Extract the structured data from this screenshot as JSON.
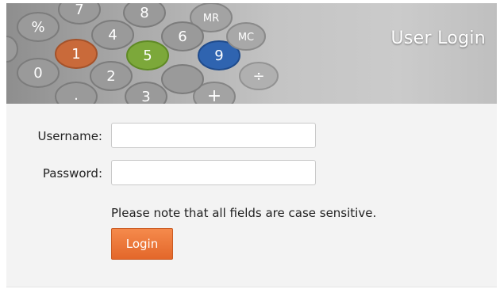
{
  "banner": {
    "title": "User Login",
    "keys": [
      "%",
      "7",
      "8",
      "MR",
      "4",
      "5",
      "6",
      "9",
      "MC",
      "0",
      "1",
      "2",
      "÷",
      "3",
      "+",
      "."
    ]
  },
  "form": {
    "username_label": "Username:",
    "username_value": "",
    "password_label": "Password:",
    "password_value": "",
    "note": "Please note that all fields are case sensitive.",
    "login_label": "Login"
  },
  "colors": {
    "login_button": "#e8702f",
    "key_orange": "#c96a3a",
    "key_green": "#7ca83a",
    "key_blue": "#2f64b0"
  }
}
